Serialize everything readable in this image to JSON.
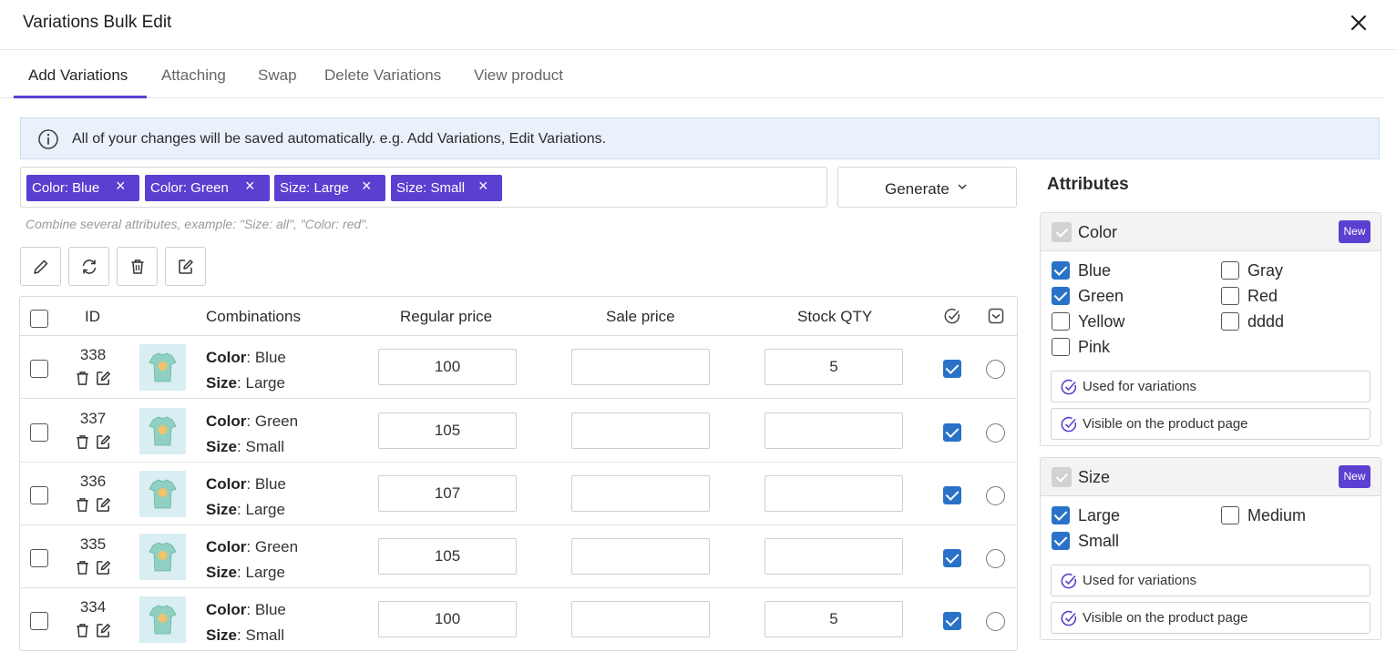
{
  "header": {
    "title": "Variations Bulk Edit"
  },
  "tabs": [
    {
      "label": "Add Variations",
      "active": true
    },
    {
      "label": "Attaching",
      "active": false
    },
    {
      "label": "Swap",
      "active": false
    },
    {
      "label": "Delete Variations",
      "active": false
    },
    {
      "label": "View product",
      "active": false
    }
  ],
  "notice": {
    "text": "All of your changes will be saved automatically. e.g. Add Variations, Edit Variations."
  },
  "tags": [
    {
      "label": "Color: Blue"
    },
    {
      "label": "Color: Green"
    },
    {
      "label": "Size: Large"
    },
    {
      "label": "Size: Small"
    }
  ],
  "generate": {
    "label": "Generate"
  },
  "hint": "Combine several attributes, example: \"Size: all\", \"Color: red\".",
  "table": {
    "headers": {
      "id": "ID",
      "combinations": "Combinations",
      "regular_price": "Regular price",
      "sale_price": "Sale price",
      "stock": "Stock QTY"
    },
    "rows": [
      {
        "id": "338",
        "color_key": "Color",
        "color": "Blue",
        "size_key": "Size",
        "size": "Large",
        "regular_price": "100",
        "sale_price": "",
        "stock": "5",
        "enabled": true
      },
      {
        "id": "337",
        "color_key": "Color",
        "color": "Green",
        "size_key": "Size",
        "size": "Small",
        "regular_price": "105",
        "sale_price": "",
        "stock": "",
        "enabled": true
      },
      {
        "id": "336",
        "color_key": "Color",
        "color": "Blue",
        "size_key": "Size",
        "size": "Large",
        "regular_price": "107",
        "sale_price": "",
        "stock": "",
        "enabled": true
      },
      {
        "id": "335",
        "color_key": "Color",
        "color": "Green",
        "size_key": "Size",
        "size": "Large",
        "regular_price": "105",
        "sale_price": "",
        "stock": "",
        "enabled": true
      },
      {
        "id": "334",
        "color_key": "Color",
        "color": "Blue",
        "size_key": "Size",
        "size": "Small",
        "regular_price": "100",
        "sale_price": "",
        "stock": "5",
        "enabled": true
      }
    ]
  },
  "attributes": {
    "title": "Attributes",
    "panels": [
      {
        "name": "Color",
        "badge": "New",
        "options": [
          {
            "label": "Blue",
            "checked": true
          },
          {
            "label": "Gray",
            "checked": false
          },
          {
            "label": "Green",
            "checked": true
          },
          {
            "label": "Red",
            "checked": false
          },
          {
            "label": "Yellow",
            "checked": false
          },
          {
            "label": "dddd",
            "checked": false
          },
          {
            "label": "Pink",
            "checked": false
          }
        ],
        "used_label": "Used for variations",
        "visible_label": "Visible on the product page"
      },
      {
        "name": "Size",
        "badge": "New",
        "options": [
          {
            "label": "Large",
            "checked": true
          },
          {
            "label": "Medium",
            "checked": false
          },
          {
            "label": "Small",
            "checked": true
          }
        ],
        "used_label": "Used for variations",
        "visible_label": "Visible on the product page"
      }
    ]
  },
  "colors": {
    "accent": "#5b3fd0",
    "checkbox": "#2a72c8",
    "notice_bg": "#eaf1fb"
  },
  "icons": {
    "close": "close-icon",
    "info": "info-icon",
    "edit": "pencil-icon",
    "refresh": "refresh-icon",
    "trash": "trash-icon",
    "bulk_edit": "edit-square-icon",
    "circle_check": "circle-check-icon",
    "chevron": "chevron-down-icon"
  }
}
